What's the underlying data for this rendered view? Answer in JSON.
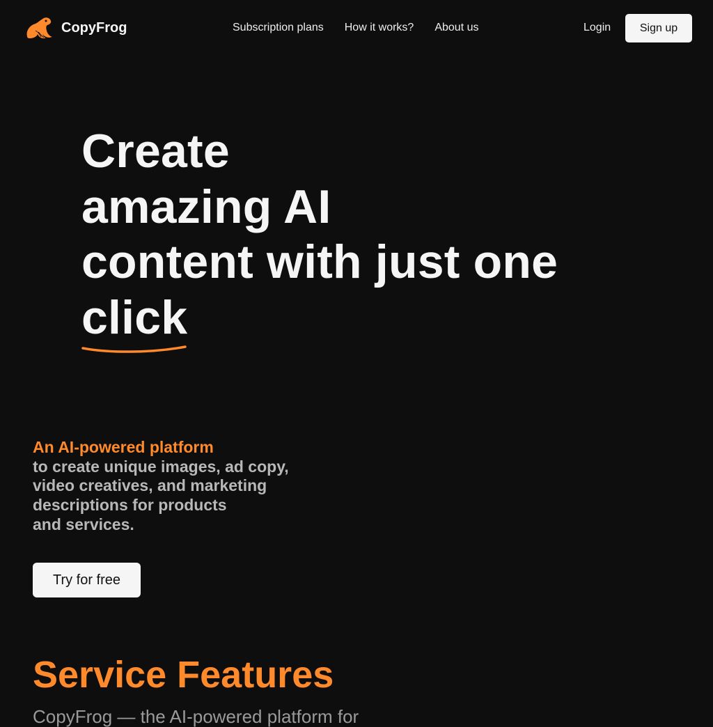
{
  "header": {
    "brand": "CopyFrog",
    "logo_icon": "frog-icon",
    "nav": [
      {
        "label": "Subscription plans"
      },
      {
        "label": "How it works?"
      },
      {
        "label": "About us"
      }
    ],
    "login_label": "Login",
    "signup_label": "Sign up"
  },
  "hero": {
    "title_lines": [
      "Create",
      "amazing AI",
      "content with just one",
      "click"
    ],
    "tagline_accent": "An AI-powered platform",
    "tagline_lines": [
      "to create unique images, ad copy,",
      "video creatives, and marketing",
      "descriptions for products",
      "and services."
    ],
    "cta_label": "Try for free"
  },
  "features": {
    "title": "Service Features",
    "subtitle": "CopyFrog — the AI-powered platform for"
  },
  "colors": {
    "background": "#0e0e0e",
    "accent": "#ff8a2b",
    "text": "#f5f5f5",
    "muted_text": "#b8b8b8",
    "button_bg": "#f5f5f5"
  }
}
